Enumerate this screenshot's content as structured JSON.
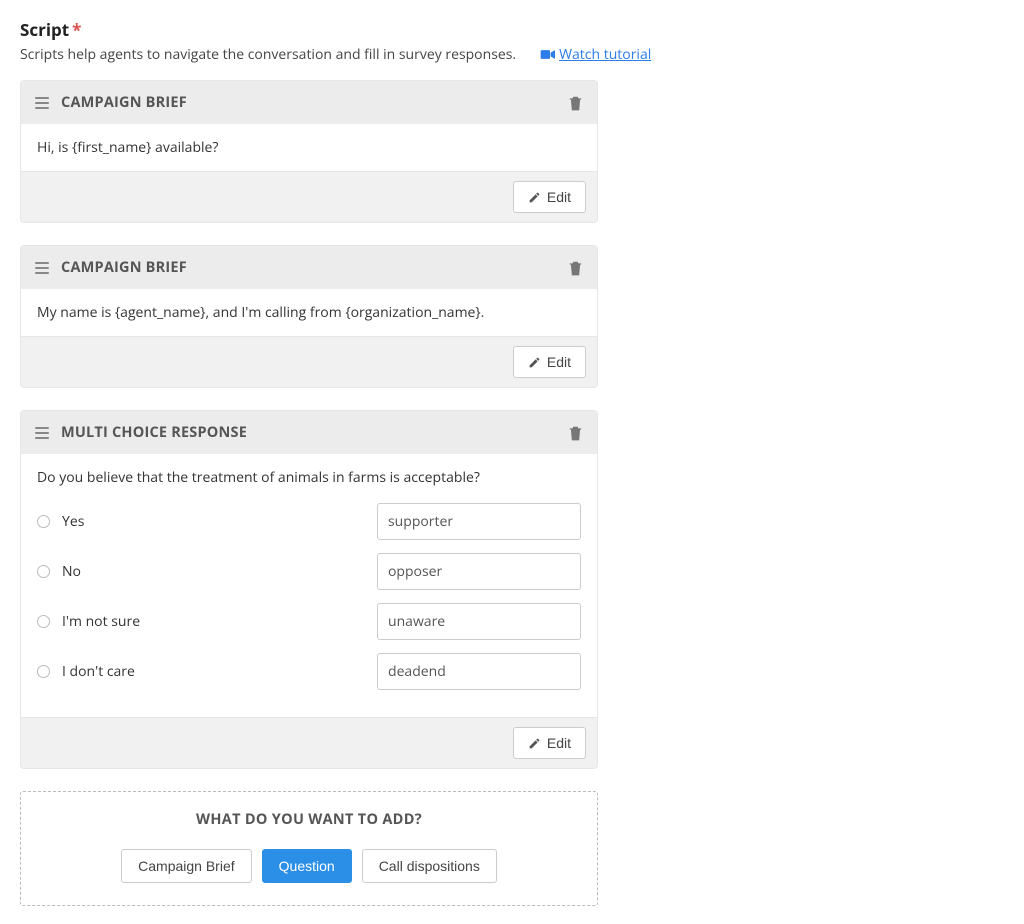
{
  "header": {
    "title": "Script",
    "required_mark": "*",
    "subhead": "Scripts help agents to navigate the conversation and fill in survey responses.",
    "tutorial_label": " Watch tutorial"
  },
  "blocks": [
    {
      "type_label": "CAMPAIGN BRIEF",
      "body_text": "Hi, is {first_name} available?",
      "edit_label": "Edit"
    },
    {
      "type_label": "CAMPAIGN BRIEF",
      "body_text": "My name is {agent_name}, and I'm calling from {organization_name}.",
      "edit_label": "Edit"
    },
    {
      "type_label": "MULTI CHOICE RESPONSE",
      "question": "Do you believe that the treatment of animals in farms is acceptable?",
      "options": [
        {
          "label": "Yes",
          "value": "supporter"
        },
        {
          "label": "No",
          "value": "opposer"
        },
        {
          "label": "I'm not sure",
          "value": "unaware"
        },
        {
          "label": "I don't care",
          "value": "deadend"
        }
      ],
      "edit_label": "Edit"
    }
  ],
  "add_section": {
    "title": "WHAT DO YOU WANT TO ADD?",
    "buttons": {
      "campaign_brief": "Campaign Brief",
      "question": "Question",
      "call_dispositions": "Call dispositions"
    }
  }
}
